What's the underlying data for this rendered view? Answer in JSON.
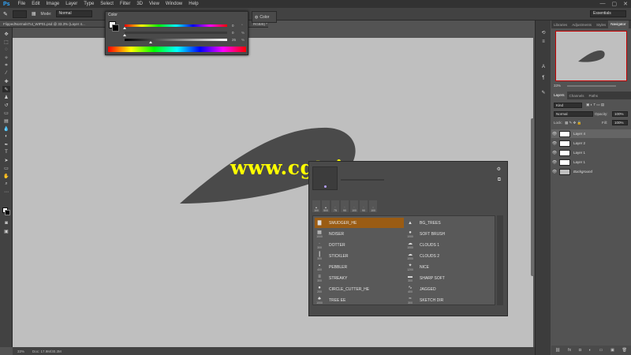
{
  "app": {
    "logo": "Ps"
  },
  "menu": [
    "File",
    "Edit",
    "Image",
    "Layer",
    "Type",
    "Select",
    "Filter",
    "3D",
    "View",
    "Window",
    "Help"
  ],
  "window_controls": {
    "minimize": "—",
    "maximize": "▢",
    "close": "✕"
  },
  "options": {
    "mode_label": "Mode:",
    "mode_value": "Normal",
    "workspace": "Essentials"
  },
  "document": {
    "tab_title": "FlippedNormalsTut_WIP01.psd @ 33.3% (Layer 4...",
    "tab_suffix": "RGB/8) *"
  },
  "color_panel": {
    "title": "Color",
    "button_label": "Color",
    "sliders": [
      {
        "value": "0",
        "unit": "°",
        "fraction": 0.0
      },
      {
        "value": "0",
        "unit": "%",
        "fraction": 0.0
      },
      {
        "value": "25",
        "unit": "%",
        "fraction": 0.25
      }
    ]
  },
  "status": {
    "zoom": "33%",
    "doc": "Doc: 17.9M/30.3M"
  },
  "navigator": {
    "tabs": [
      "Libraries",
      "Adjustments",
      "Styles",
      "Navigator"
    ],
    "zoom": "33%"
  },
  "layers_panel": {
    "tabs": [
      "Layers",
      "Channels",
      "Paths"
    ],
    "filter": "Kind",
    "blend_mode": "Normal",
    "opacity_label": "Opacity:",
    "opacity_value": "100%",
    "lock_label": "Lock:",
    "fill_label": "Fill:",
    "fill_value": "100%",
    "layers": [
      {
        "name": "Layer 4",
        "selected": true
      },
      {
        "name": "Layer 2",
        "selected": false
      },
      {
        "name": "Layer 1",
        "selected": false
      },
      {
        "name": "Layer 1",
        "selected": false
      },
      {
        "name": "Background",
        "selected": false
      }
    ]
  },
  "brush_picker": {
    "strip": [
      "100",
      "500",
      "75",
      "90",
      "100",
      "90",
      "100"
    ],
    "brushes": [
      {
        "name": "SMUDGER_HE",
        "num": "",
        "glyph": "▇",
        "selected": true
      },
      {
        "name": "BG_TREES",
        "num": "",
        "glyph": "▲",
        "selected": false
      },
      {
        "name": "NOISER",
        "num": "1000",
        "glyph": "▦",
        "selected": false
      },
      {
        "name": "SOFT BRUSH",
        "num": "1000",
        "glyph": "●",
        "selected": false
      },
      {
        "name": "DOTTER",
        "num": "300",
        "glyph": "·",
        "selected": false
      },
      {
        "name": "CLOUDS 1",
        "num": "1000",
        "glyph": "☁",
        "selected": false
      },
      {
        "name": "STICKLER",
        "num": "300",
        "glyph": "┃",
        "selected": false
      },
      {
        "name": "CLOUDS 2",
        "num": "1000",
        "glyph": "☁",
        "selected": false
      },
      {
        "name": "PEBBLER",
        "num": "400",
        "glyph": "▪",
        "selected": false
      },
      {
        "name": "NICE",
        "num": "1200",
        "glyph": "✦",
        "selected": false
      },
      {
        "name": "STREAKY",
        "num": "300",
        "glyph": "≡",
        "selected": false
      },
      {
        "name": "SHARP SOFT",
        "num": "300",
        "glyph": "▬",
        "selected": false
      },
      {
        "name": "CIRCLE_CUTTER_HE",
        "num": "200",
        "glyph": "●",
        "selected": false
      },
      {
        "name": "JAGGED",
        "num": "400",
        "glyph": "∿",
        "selected": false
      },
      {
        "name": "TREE EE",
        "num": "1000",
        "glyph": "♣",
        "selected": false
      },
      {
        "name": "SKETCH DIR",
        "num": "300",
        "glyph": "≈",
        "selected": false
      }
    ]
  },
  "watermark": "www.cgtsj.com",
  "colors": {
    "canvas": "#bfbfbf",
    "shape": "#4a4a4a",
    "accent_selected": "#9a5c14",
    "watermark": "#ffff00"
  }
}
